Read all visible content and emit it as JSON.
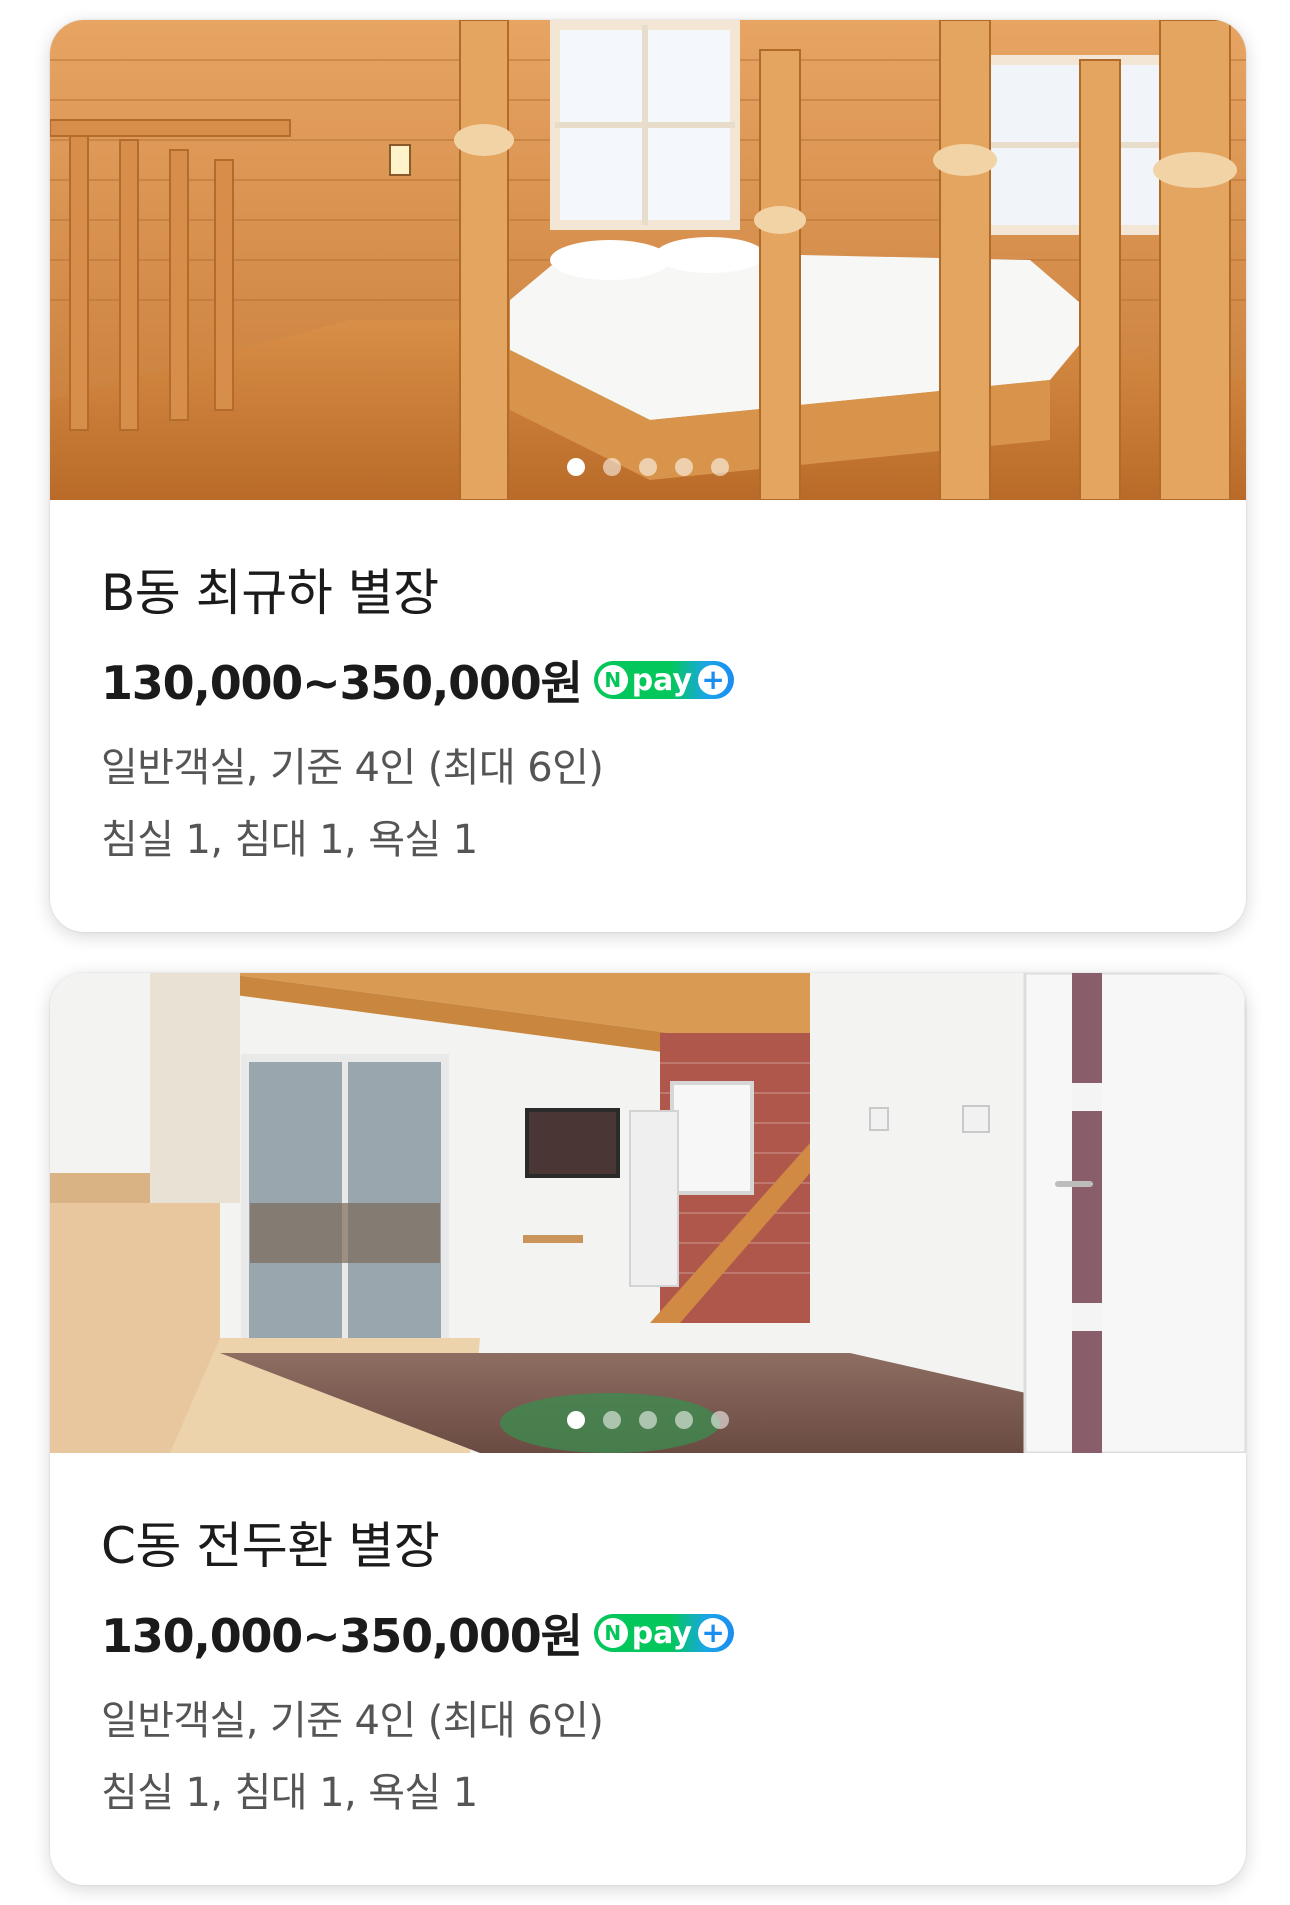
{
  "rooms": [
    {
      "image": "log-cabin-loft-bedroom",
      "carousel": {
        "count": 5,
        "active": 1
      },
      "name": "B동 최규하 별장",
      "price": "130,000~350,000원",
      "pay_badge": {
        "n": "N",
        "text": "pay",
        "plus": "+"
      },
      "room_type": "일반객실, 기준 4인 (최대 6인)",
      "facilities": "침실 1, 침대 1, 욕실 1"
    },
    {
      "image": "living-room-with-tv-and-door",
      "carousel": {
        "count": 5,
        "active": 1
      },
      "name": "C동 전두환 별장",
      "price": "130,000~350,000원",
      "pay_badge": {
        "n": "N",
        "text": "pay",
        "plus": "+"
      },
      "room_type": "일반객실, 기준 4인 (최대 6인)",
      "facilities": "침실 1, 침대 1, 욕실 1"
    }
  ],
  "colors": {
    "npay_green": "#03c75a",
    "npay_blue": "#1a8df0",
    "title_text": "#1b1b1b",
    "desc_text": "#555555"
  }
}
